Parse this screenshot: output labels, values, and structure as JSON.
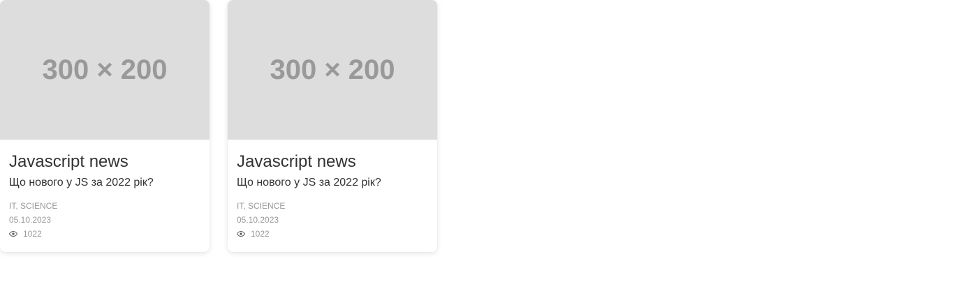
{
  "cards": [
    {
      "image_text": "300 × 200",
      "title": "Javascript news",
      "subtitle": "Що нового у JS за 2022 рік?",
      "categories": "IT, SCIENCE",
      "date": "05.10.2023",
      "views": "1022",
      "views_icon": "eye-icon"
    },
    {
      "image_text": "300 × 200",
      "title": "Javascript news",
      "subtitle": "Що нового у JS за 2022 рік?",
      "categories": "IT, SCIENCE",
      "date": "05.10.2023",
      "views": "1022",
      "views_icon": "eye-icon"
    }
  ],
  "colors": {
    "placeholder_bg": "#dddddd",
    "placeholder_text": "#999999",
    "title_text": "#333333",
    "meta_text": "#999999"
  }
}
